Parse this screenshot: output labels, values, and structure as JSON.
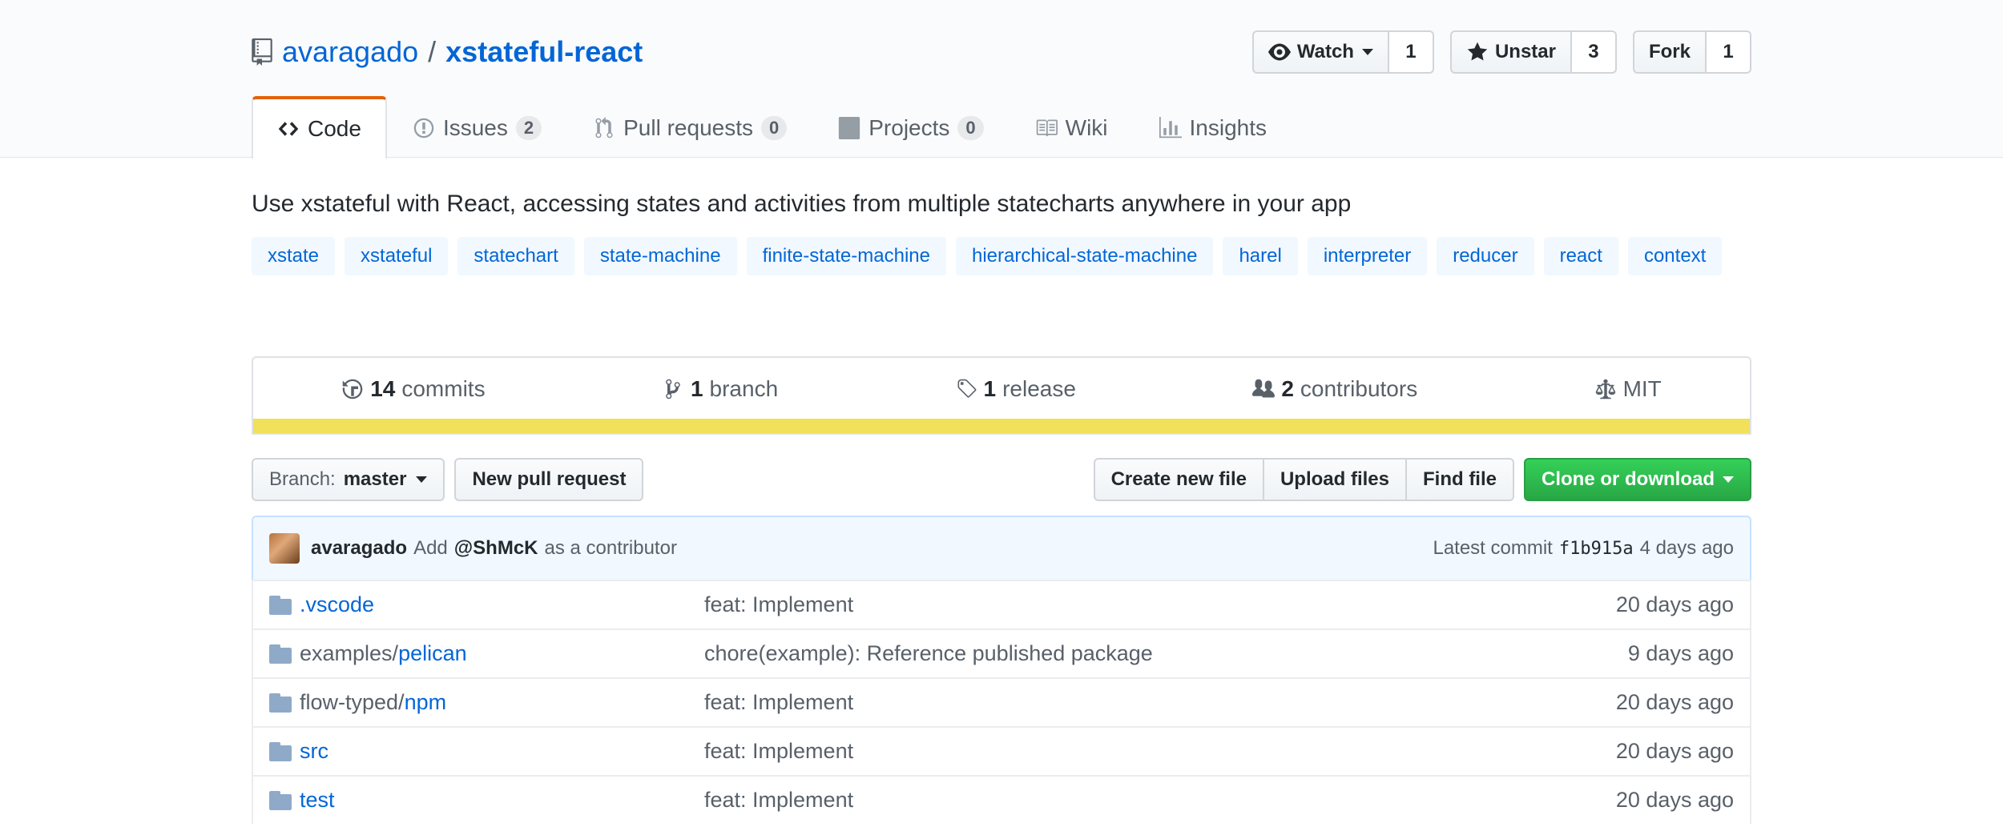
{
  "repo": {
    "owner": "avaragado",
    "separator": "/",
    "name": "xstateful-react"
  },
  "actions": {
    "watch_label": "Watch",
    "watch_count": "1",
    "star_label": "Unstar",
    "star_count": "3",
    "fork_label": "Fork",
    "fork_count": "1"
  },
  "tabs": [
    {
      "label": "Code",
      "count": null
    },
    {
      "label": "Issues",
      "count": "2"
    },
    {
      "label": "Pull requests",
      "count": "0"
    },
    {
      "label": "Projects",
      "count": "0"
    },
    {
      "label": "Wiki",
      "count": null
    },
    {
      "label": "Insights",
      "count": null
    }
  ],
  "description": "Use xstateful with React, accessing states and activities from multiple statecharts anywhere in your app",
  "topics": [
    "xstate",
    "xstateful",
    "statechart",
    "state-machine",
    "finite-state-machine",
    "hierarchical-state-machine",
    "harel",
    "interpreter",
    "reducer",
    "react",
    "context"
  ],
  "summary": {
    "commits_count": "14",
    "commits_label": "commits",
    "branches_count": "1",
    "branches_label": "branch",
    "releases_count": "1",
    "releases_label": "release",
    "contributors_count": "2",
    "contributors_label": "contributors",
    "license": "MIT",
    "lang_color": "#f1e05a"
  },
  "filenav": {
    "branch_prefix": "Branch:",
    "branch_name": "master",
    "new_pr": "New pull request",
    "create_file": "Create new file",
    "upload_files": "Upload files",
    "find_file": "Find file",
    "clone": "Clone or download"
  },
  "commit": {
    "author": "avaragado",
    "message_prefix": "Add",
    "mention": "@ShMcK",
    "message_suffix": "as a contributor",
    "latest_label": "Latest commit",
    "sha": "f1b915a",
    "age": "4 days ago"
  },
  "files": [
    {
      "prefix": "",
      "link": ".vscode",
      "message": "feat: Implement",
      "age": "20 days ago"
    },
    {
      "prefix": "examples/",
      "link": "pelican",
      "message": "chore(example): Reference published package",
      "age": "9 days ago"
    },
    {
      "prefix": "flow-typed/",
      "link": "npm",
      "message": "feat: Implement",
      "age": "20 days ago"
    },
    {
      "prefix": "",
      "link": "src",
      "message": "feat: Implement",
      "age": "20 days ago"
    },
    {
      "prefix": "",
      "link": "test",
      "message": "feat: Implement",
      "age": "20 days ago"
    }
  ]
}
